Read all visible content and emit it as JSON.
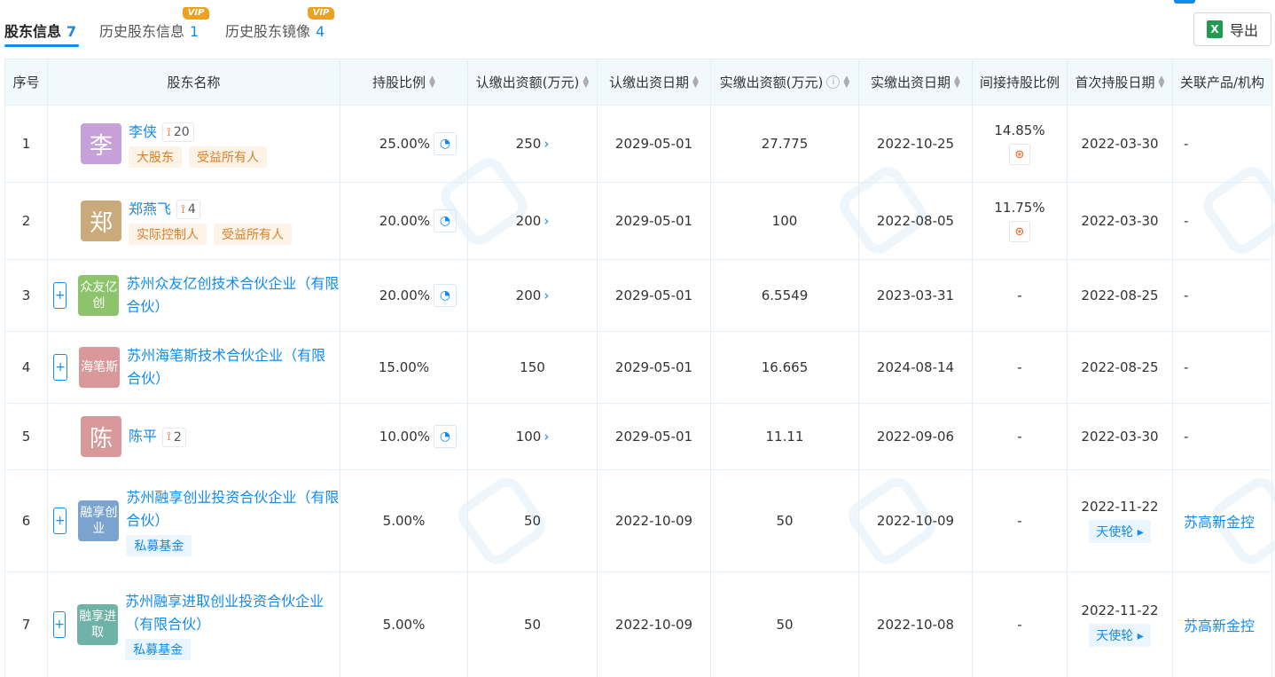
{
  "tabs": [
    {
      "label": "股东信息",
      "count": "7",
      "vip": ""
    },
    {
      "label": "历史股东信息",
      "count": "1",
      "vip": "VIP"
    },
    {
      "label": "历史股东镜像",
      "count": "4",
      "vip": "VIP"
    }
  ],
  "export_label": "导出",
  "export_icon": "excel-icon",
  "columns": [
    "序号",
    "股东名称",
    "持股比例",
    "认缴出资额(万元)",
    "认缴出资日期",
    "实缴出资额(万元)",
    "实缴出资日期",
    "间接持股比例",
    "首次持股日期",
    "关联产品/机构"
  ],
  "rows": [
    {
      "index": "1",
      "avatar_text": "李",
      "avatar_color": "#c79fd9",
      "name": "李侠",
      "holdings": "20",
      "tags": [
        "大股东",
        "受益所有人"
      ],
      "tag_style": "orange",
      "expandable": false,
      "ratio": "25.00%",
      "sub_amount": "250",
      "sub_link": true,
      "sub_date": "2029-05-01",
      "paid_amount": "27.775",
      "paid_date": "2022-10-25",
      "indirect": "14.85%",
      "first_date": "2022-03-30",
      "round": "",
      "related": "-"
    },
    {
      "index": "2",
      "avatar_text": "郑",
      "avatar_color": "#caa97a",
      "name": "郑燕飞",
      "holdings": "4",
      "tags": [
        "实际控制人",
        "受益所有人"
      ],
      "tag_style": "orange",
      "expandable": false,
      "ratio": "20.00%",
      "sub_amount": "200",
      "sub_link": true,
      "sub_date": "2029-05-01",
      "paid_amount": "100",
      "paid_date": "2022-08-05",
      "indirect": "11.75%",
      "first_date": "2022-03-30",
      "round": "",
      "related": "-"
    },
    {
      "index": "3",
      "avatar_text": "众友亿创",
      "avatar_color": "#8cc36b",
      "name": "苏州众友亿创技术合伙企业（有限合伙）",
      "holdings": "",
      "tags": [],
      "tag_style": "",
      "expandable": true,
      "ratio": "20.00%",
      "sub_amount": "200",
      "sub_link": true,
      "sub_date": "2029-05-01",
      "paid_amount": "6.5549",
      "paid_date": "2023-03-31",
      "indirect": "-",
      "first_date": "2022-08-25",
      "round": "",
      "related": "-"
    },
    {
      "index": "4",
      "avatar_text": "海笔斯",
      "avatar_color": "#d9999a",
      "name": "苏州海笔斯技术合伙企业（有限合伙）",
      "holdings": "",
      "tags": [],
      "tag_style": "",
      "expandable": true,
      "ratio": "15.00%",
      "sub_amount": "150",
      "sub_link": false,
      "sub_date": "2029-05-01",
      "paid_amount": "16.665",
      "paid_date": "2024-08-14",
      "indirect": "-",
      "first_date": "2022-08-25",
      "round": "",
      "related": "-"
    },
    {
      "index": "5",
      "avatar_text": "陈",
      "avatar_color": "#d9999a",
      "name": "陈平",
      "holdings": "2",
      "tags": [],
      "tag_style": "",
      "expandable": false,
      "ratio": "10.00%",
      "sub_amount": "100",
      "sub_link": true,
      "sub_date": "2029-05-01",
      "paid_amount": "11.11",
      "paid_date": "2022-09-06",
      "indirect": "-",
      "first_date": "2022-03-30",
      "round": "",
      "related": "-"
    },
    {
      "index": "6",
      "avatar_text": "融享创业",
      "avatar_color": "#7ba3cf",
      "name": "苏州融享创业投资合伙企业（有限合伙）",
      "holdings": "",
      "tags": [
        "私募基金"
      ],
      "tag_style": "blue",
      "expandable": true,
      "ratio": "5.00%",
      "sub_amount": "50",
      "sub_link": false,
      "sub_date": "2022-10-09",
      "paid_amount": "50",
      "paid_date": "2022-10-09",
      "indirect": "-",
      "first_date": "2022-11-22",
      "round": "天使轮",
      "related": "苏高新金控"
    },
    {
      "index": "7",
      "avatar_text": "融享进取",
      "avatar_color": "#6fb3a8",
      "name": "苏州融享进取创业投资合伙企业（有限合伙）",
      "holdings": "",
      "tags": [
        "私募基金"
      ],
      "tag_style": "blue",
      "expandable": true,
      "ratio": "5.00%",
      "sub_amount": "50",
      "sub_link": false,
      "sub_date": "2022-10-09",
      "paid_amount": "50",
      "paid_date": "2022-10-08",
      "indirect": "-",
      "first_date": "2022-11-22",
      "round": "天使轮",
      "related": "苏高新金控"
    }
  ]
}
